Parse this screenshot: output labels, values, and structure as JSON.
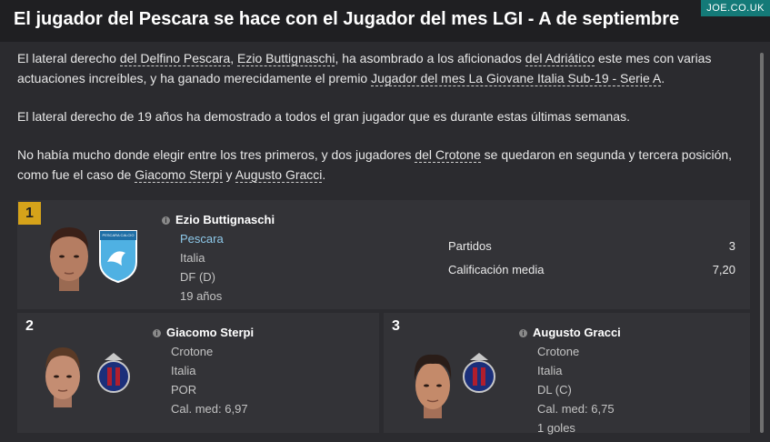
{
  "title": "El jugador del Pescara se hace con el Jugador del mes LGI - A de septiembre",
  "watermark": "JOE.CO.UK",
  "paragraph1": {
    "t1": "El lateral derecho ",
    "club": "del Delfino Pescara",
    "t2": ", ",
    "player": "Ezio Buttignaschi",
    "t3": ", ha asombrado a los aficionados ",
    "fans": "del Adriático",
    "t4": " este mes con varias actuaciones increíbles, y ha ganado merecidamente el premio ",
    "award": "Jugador del mes La Giovane Italia Sub-19 - Serie A",
    "t5": "."
  },
  "paragraph2": "El lateral derecho de 19 años ha demostrado a todos el gran jugador que es durante estas últimas semanas.",
  "paragraph3": {
    "t1": "No había mucho donde elegir entre los tres primeros, y dos jugadores ",
    "club": "del Crotone",
    "t2": " se quedaron en segunda y tercera posición, como fue el caso de ",
    "p2": "Giacomo Sterpi",
    "t3": " y ",
    "p3": "Augusto Gracci",
    "t4": "."
  },
  "first": {
    "rank": "1",
    "name": "Ezio Buttignaschi",
    "club": "Pescara",
    "nation": "Italia",
    "position": "DF (D)",
    "age": "19 años",
    "badge_text": "PESCARA CALCIO",
    "stats": [
      {
        "label": "Partidos",
        "value": "3"
      },
      {
        "label": "Calificación media",
        "value": "7,20"
      }
    ]
  },
  "second": {
    "rank": "2",
    "name": "Giacomo Sterpi",
    "club": "Crotone",
    "nation": "Italia",
    "position": "POR",
    "rating": "Cal. med: 6,97"
  },
  "third": {
    "rank": "3",
    "name": "Augusto Gracci",
    "club": "Crotone",
    "nation": "Italia",
    "position": "DL (C)",
    "rating": "Cal. med: 6,75",
    "goals": "1 goles"
  },
  "colors": {
    "background": "#2b2b2f",
    "gold": "#d6a31a",
    "link_blue": "#8ec9ea",
    "watermark": "#147a78"
  }
}
